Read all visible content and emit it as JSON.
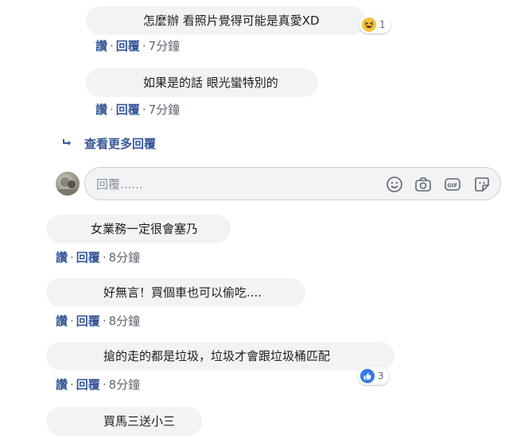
{
  "replies": [
    {
      "text": "怎麼辦 看照片覺得可能是真愛XD",
      "like": "讚",
      "reply": "回覆",
      "time": "7分鐘",
      "reaction_count": "1",
      "reaction_type": "haha-emoji"
    },
    {
      "text": "如果是的話 眼光蠻特別的",
      "like": "讚",
      "reply": "回覆",
      "time": "7分鐘"
    }
  ],
  "more_replies": {
    "label": "查看更多回覆",
    "icon": "reply-arrow-icon"
  },
  "reply_box": {
    "placeholder": "回覆......",
    "icons": [
      "smiley-icon",
      "camera-icon",
      "gif-icon",
      "sticker-icon"
    ]
  },
  "comments": [
    {
      "text": "女業務一定很會塞乃",
      "like": "讚",
      "reply": "回覆",
      "time": "8分鐘"
    },
    {
      "text": "好無言！買個車也可以偷吃....",
      "like": "讚",
      "reply": "回覆",
      "time": "8分鐘"
    },
    {
      "text": "搶的走的都是垃圾，垃圾才會跟垃圾桶匹配",
      "like": "讚",
      "reply": "回覆",
      "time": "8分鐘",
      "reaction_count": "3",
      "reaction_type": "like-icon"
    },
    {
      "text": "買馬三送小三"
    }
  ],
  "colors": {
    "link": "#385898",
    "bubble": "#f2f3f5",
    "muted": "#606770",
    "like_blue": "#3578e5",
    "haha_yellow": "#f7c23c"
  }
}
